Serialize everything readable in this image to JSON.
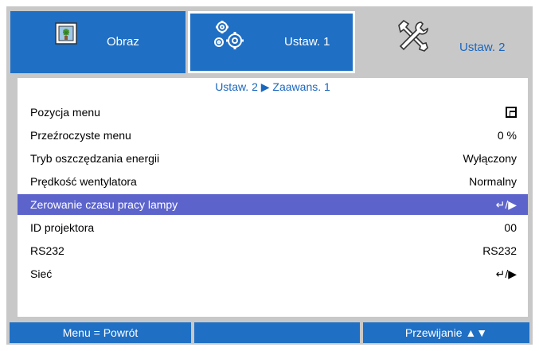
{
  "tabs": [
    {
      "label": "Obraz",
      "icon": "image-icon"
    },
    {
      "label": "Ustaw. 1",
      "icon": "gears-icon"
    },
    {
      "label": "Ustaw. 2",
      "icon": "tools-icon"
    }
  ],
  "breadcrumb": "Ustaw. 2 ▶ Zaawans. 1",
  "rows": [
    {
      "label": "Pozycja menu",
      "value": ""
    },
    {
      "label": "Przeźroczyste menu",
      "value": "0 %"
    },
    {
      "label": "Tryb oszczędzania energii",
      "value": "Wyłączony"
    },
    {
      "label": "Prędkość wentylatora",
      "value": "Normalny"
    },
    {
      "label": "Zerowanie czasu pracy lampy",
      "value": "↵/▶"
    },
    {
      "label": "ID projektora",
      "value": "00"
    },
    {
      "label": "RS232",
      "value": "RS232"
    },
    {
      "label": "Sieć",
      "value": "↵/▶"
    }
  ],
  "selected_row": "Zerowanie czasu pracy lampy",
  "footer": {
    "left": "Menu = Powrót",
    "middle": "",
    "right": "Przewijanie ▲▼"
  },
  "colors": {
    "tab_blue": "#1f6fc4",
    "selection": "#5c64cc",
    "frame_gray": "#c8c8c8",
    "accent_text": "#1a67c0"
  }
}
